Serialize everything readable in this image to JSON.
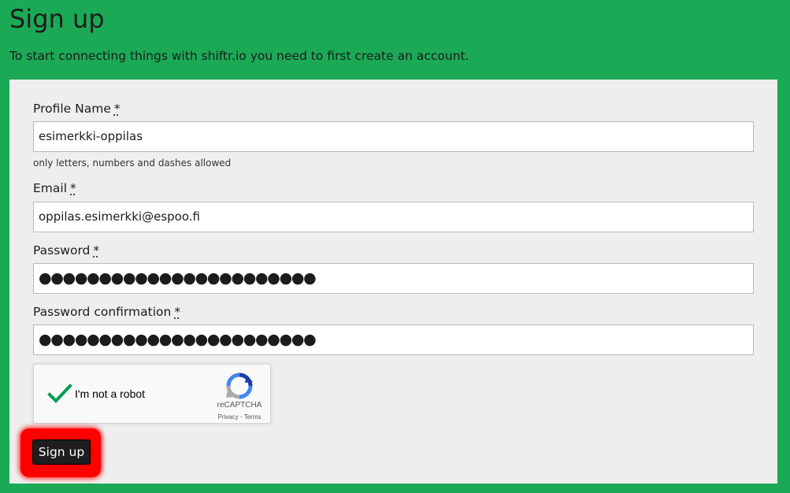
{
  "page": {
    "title": "Sign up",
    "intro": "To start connecting things with shiftr.io you need to first create an account."
  },
  "form": {
    "profile_name": {
      "label": "Profile Name",
      "required_mark": "*",
      "value": "esimerkki-oppilas",
      "hint": "only letters, numbers and dashes allowed"
    },
    "email": {
      "label": "Email",
      "required_mark": "*",
      "value": "oppilas.esimerkki@espoo.fi"
    },
    "password": {
      "label": "Password",
      "required_mark": "*",
      "masked_value": "●●●●●●●●●●●●●●●●●●●●●●●"
    },
    "password_confirmation": {
      "label": "Password confirmation",
      "required_mark": "*",
      "masked_value": "●●●●●●●●●●●●●●●●●●●●●●●"
    },
    "recaptcha": {
      "label": "I'm not a robot",
      "brand": "reCAPTCHA",
      "links": "Privacy - Terms",
      "checked": true
    },
    "submit_label": "Sign up"
  },
  "colors": {
    "background": "#1ba955",
    "panel": "#eeeeee",
    "button": "#1e1e1e",
    "highlight": "#ff0000",
    "check": "#009e55"
  },
  "icons": {
    "checkmark": "checkmark-icon",
    "recaptcha": "recaptcha-logo-icon"
  }
}
